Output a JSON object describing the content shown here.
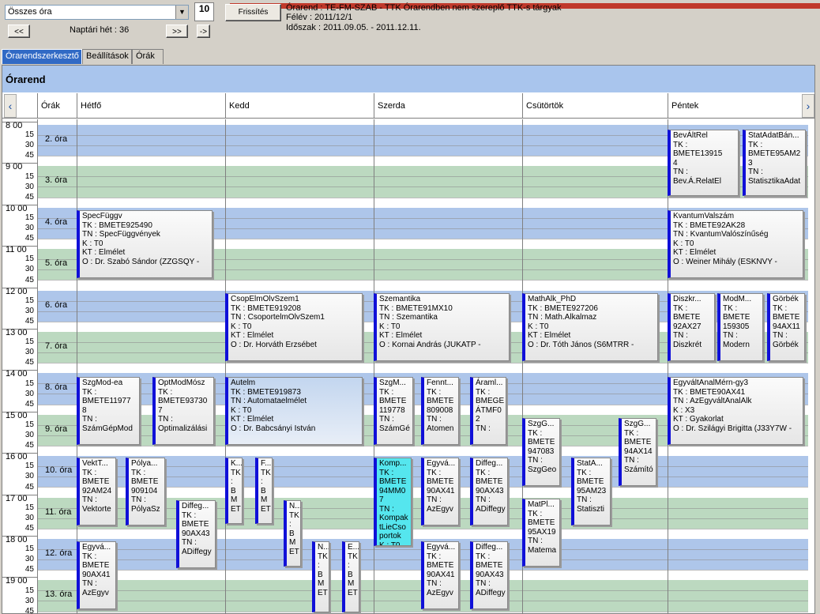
{
  "toolbar": {
    "combo_value": "Összes óra",
    "calendar_day": "10",
    "refresh": "Frissítés",
    "prev": "<<",
    "next": ">>",
    "jump": "->",
    "week_label": "Naptári hét : 36"
  },
  "info": {
    "line1": "Órarend : TE-FM-SZAB - TTK Órarendben nem szereplő TTK-s tárgyak",
    "line2": "Félév : 2011/12/1",
    "line3": "Időszak : 2011.09.05. - 2011.12.11."
  },
  "tabs": [
    {
      "label": "Órarendszerkesztő"
    },
    {
      "label": "Beállítások"
    },
    {
      "label": "Órák"
    }
  ],
  "schedule_title": "Órarend",
  "columns": {
    "orak": "Órák",
    "d1": "Hétfő",
    "d2": "Kedd",
    "d3": "Szerda",
    "d4": "Csütörtök",
    "d5": "Péntek"
  },
  "hours": [
    "8",
    "9",
    "10",
    "11",
    "12",
    "13",
    "14",
    "15",
    "16",
    "17",
    "18",
    "19"
  ],
  "periods": [
    "2. óra",
    "3. óra",
    "4. óra",
    "5. óra",
    "6. óra",
    "7. óra",
    "8. óra",
    "9. óra",
    "10. óra",
    "11. óra",
    "12. óra",
    "13. óra"
  ],
  "events": [
    {
      "text": "BevÁltRel\nTK :\nBMETE13915\n4\nTN :\nBev.Á.RelatEl"
    },
    {
      "text": "StatAdatBán...\nTK :\nBMETE95AM2\n3\nTN :\nStatisztikaAdat"
    },
    {
      "text": "SpecFüggv\nTK : BMETE925490\nTN : SpecFüggvények\nK : T0\nKT : Elmélet\nO :  Dr. Szabó Sándor (ZZGSQY -"
    },
    {
      "text": "KvantumValszám\nTK : BMETE92AK28\nTN : KvantumValószínűség\nK : T0\nKT : Elmélet\nO :  Weiner Mihály (ESKNVY -"
    },
    {
      "text": "CsopElmOlvSzem1\nTK : BMETE919208\nTN : CsoportelmOlvSzem1\nK : T0\nKT : Elmélet\nO :  Dr. Horváth Erzsébet"
    },
    {
      "text": "Szemantika\nTK : BMETE91MX10\nTN : Szemantika\nK : T0\nKT : Elmélet\nO :  Kornai András (JUKATP -"
    },
    {
      "text": "MathAlk_PhD\nTK : BMETE927206\nTN : Math.Alkalmaz\nK : T0\nKT : Elmélet\nO :  Dr. Tóth János (S6MTRR -"
    },
    {
      "text": "Diszkr...\nTK :\nBMETE\n92AX27\nTN :\nDiszkrét"
    },
    {
      "text": "ModM...\nTK :\nBMETE\n159305\nTN :\nModern"
    },
    {
      "text": "Görbék\nTK :\nBMETE\n94AX11\nTN :\nGörbék"
    },
    {
      "text": "SzgMod-ea\nTK :\nBMETE11977\n8\nTN :\nSzámGépMod"
    },
    {
      "text": "OptModMósz\nTK :\nBMETE93730\n7\nTN :\nOptimalizálási"
    },
    {
      "text": "Autelm\nTK : BMETE919873\nTN : Automataelmélet\nK : T0\nKT : Elmélet\nO :  Dr. Babcsányi István"
    },
    {
      "text": "SzgM...\nTK :\nBMETE\n119778\nTN :\nSzámGé"
    },
    {
      "text": "Fennt...\nTK :\nBMETE\n809008\nTN :\nAtomen"
    },
    {
      "text": "Áraml...\nTK :\nBMEGE\nÁTMF0\n2\nTN :"
    },
    {
      "text": "EgyváltAnalMérn-gy3\nTK : BMETE90AX41\nTN : AzEgyváltAnalAlk\nK : X3\nKT : Gyakorlat\nO :  Dr. Szilágyi Brigitta (J33Y7W -"
    },
    {
      "text": "SzgG...\nTK :\nBMETE\n947083\nTN :\nSzgGeo"
    },
    {
      "text": "SzgG...\nTK :\nBMETE\n94AX14\nTN :\nSzámító"
    },
    {
      "text": "VektT...\nTK :\nBMETE\n92AM24\nTN :\nVektorte"
    },
    {
      "text": "Pólya...\nTK :\nBMETE\n909104\nTN :\nPólyaSz"
    },
    {
      "text": "Diffeg...\nTK :\nBMETE\n90AX43\nTN :\nADiffegy"
    },
    {
      "text": "K...\nTK\n:\nB\nM\nET"
    },
    {
      "text": "F...\nTK\n:\nB\nM\nET"
    },
    {
      "text": "N...\nTK\n:\nB\nM\nET"
    },
    {
      "text": "Komp...\nTK :\nBMETE\n94MM0\n7\nTN :\nKompak\ntLieCso\nportok\nK : T0"
    },
    {
      "text": "Egyvá...\nTK :\nBMETE\n90AX41\nTN :\nAzEgyv"
    },
    {
      "text": "Diffeg...\nTK :\nBMETE\n90AX43\nTN :\nADiffegy"
    },
    {
      "text": "StatA...\nTK :\nBMETE\n95AM23\nTN :\nStatiszti"
    },
    {
      "text": "MatPl...\nTK :\nBMETE\n95AX19\nTN :\nMatema"
    },
    {
      "text": "Egyvá...\nTK :\nBMETE\n90AX41\nTN :\nAzEgyv"
    },
    {
      "text": "N...\nTK\n:\nB\nM\nET"
    },
    {
      "text": "E...\nTK\n:\nB\nM\nET"
    },
    {
      "text": "Egyvá...\nTK :\nBMETE\n90AX41\nTN :\nAzEgyv"
    },
    {
      "text": "Diffeg...\nTK :\nBMETE\n90AX43\nTN :\nADiffegy"
    }
  ],
  "colors": {
    "accent": "#316ac5",
    "event_bar": "#1010d8",
    "blue_band": "#aec6ea",
    "green_band": "#bcd9c0",
    "selected_event": "#55e6ee"
  }
}
